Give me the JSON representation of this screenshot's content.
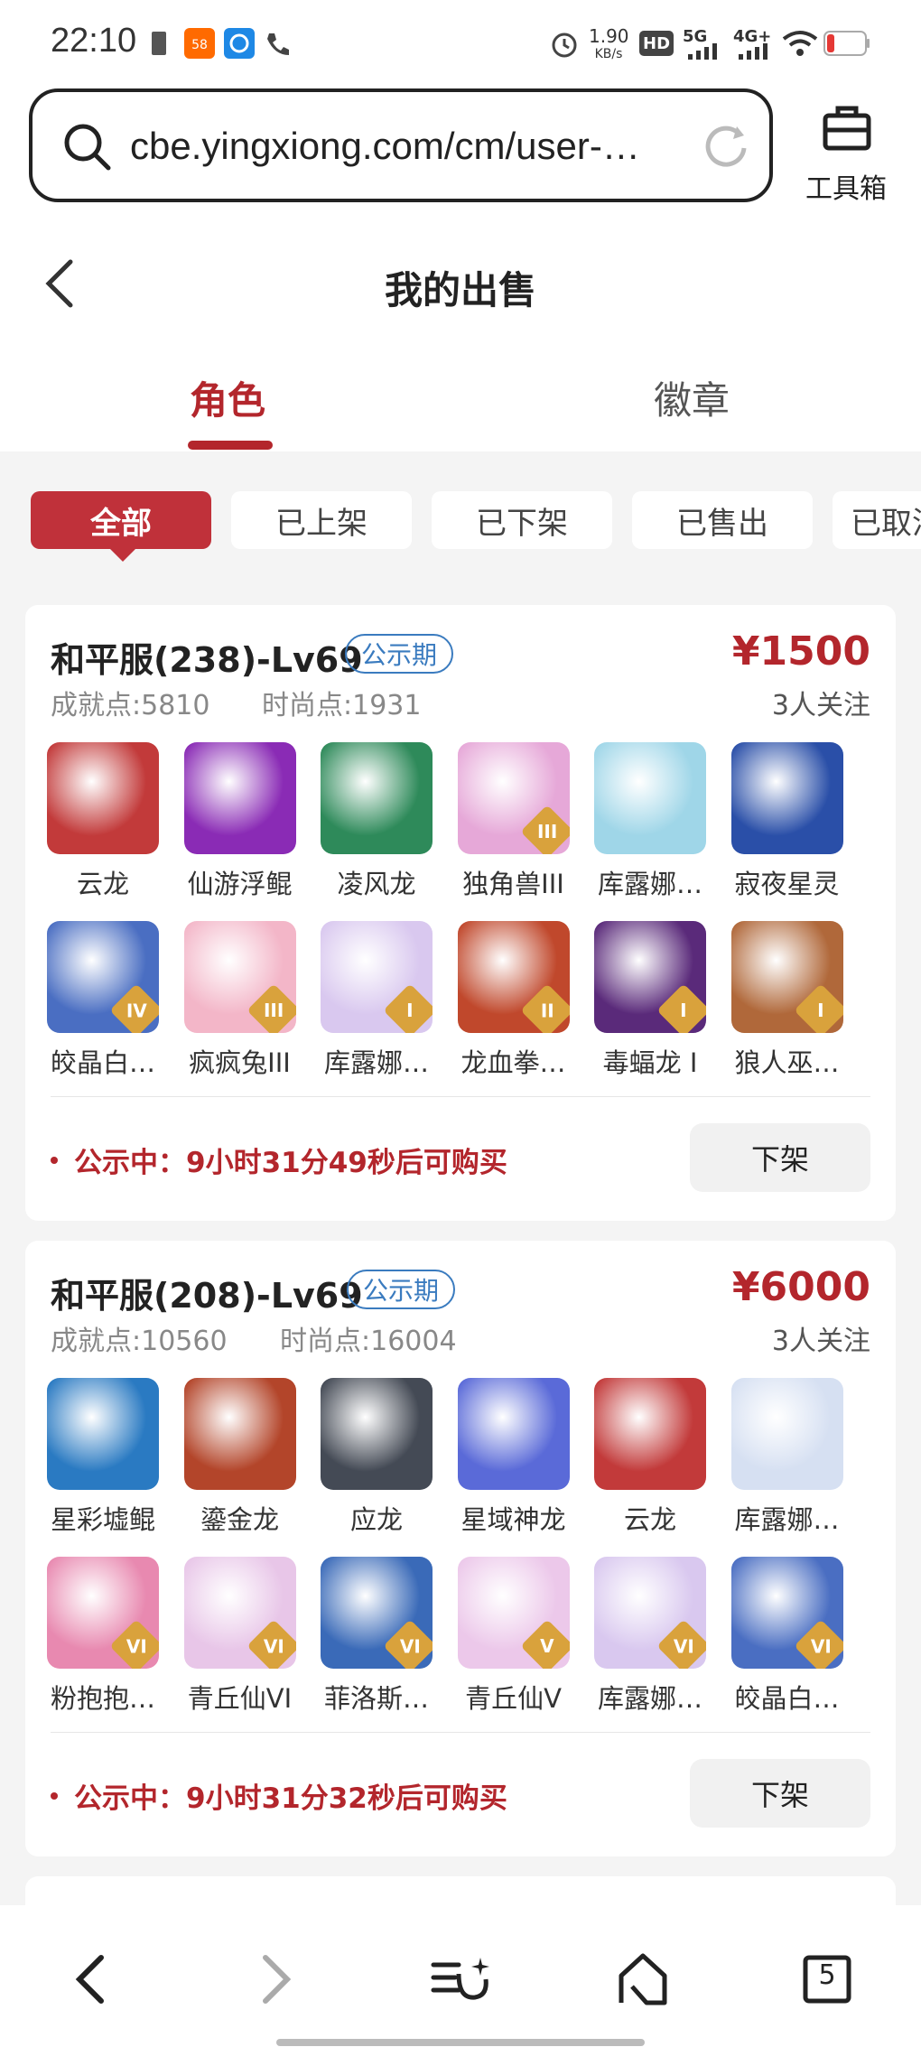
{
  "status_bar": {
    "time": "22:10",
    "net_speed": "1.90",
    "net_unit": "KB/s",
    "hd": "HD",
    "sig1": "5G",
    "sig2": "4G+"
  },
  "browser": {
    "url": "cbe.yingxiong.com/cm/user-…",
    "toolbox_label": "工具箱"
  },
  "header": {
    "title": "我的出售",
    "tabs": [
      "角色",
      "徽章"
    ]
  },
  "filters": [
    "全部",
    "已上架",
    "已下架",
    "已售出",
    "已取消"
  ],
  "listings": [
    {
      "server": "和平服(238)-Lv69",
      "badge": "公示期",
      "price": "¥1500",
      "followers": "3人关注",
      "achievement_label": "成就点:",
      "achievement": "5810",
      "fashion_label": "时尚点:",
      "fashion": "1931",
      "pets": [
        {
          "name": "云龙",
          "color": "#c23a3a",
          "tier": ""
        },
        {
          "name": "仙游浮鲲",
          "color": "#8a2bb5",
          "tier": ""
        },
        {
          "name": "凌风龙",
          "color": "#2e8a5a",
          "tier": ""
        },
        {
          "name": "独角兽III",
          "color": "#e6a8d8",
          "tier": "III"
        },
        {
          "name": "库露娜…",
          "color": "#9fd6e8",
          "tier": ""
        },
        {
          "name": "寂夜星灵",
          "color": "#2a4fa8",
          "tier": ""
        },
        {
          "name": "皎晶白…",
          "color": "#4a6ec2",
          "tier": "IV"
        },
        {
          "name": "疯疯兔III",
          "color": "#f3b6c8",
          "tier": "III"
        },
        {
          "name": "库露娜…",
          "color": "#d9c8ef",
          "tier": "I"
        },
        {
          "name": "龙血拳…",
          "color": "#c0482c",
          "tier": "II"
        },
        {
          "name": "毒蝠龙 I",
          "color": "#5a2a7a",
          "tier": "I"
        },
        {
          "name": "狼人巫…",
          "color": "#b0683a",
          "tier": "I"
        }
      ],
      "notice": "公示中：9小时31分49秒后可购买",
      "action": "下架"
    },
    {
      "server": "和平服(208)-Lv69",
      "badge": "公示期",
      "price": "¥6000",
      "followers": "3人关注",
      "achievement_label": "成就点:",
      "achievement": "10560",
      "fashion_label": "时尚点:",
      "fashion": "16004",
      "pets": [
        {
          "name": "星彩墟鲲",
          "color": "#2a7ac2",
          "tier": ""
        },
        {
          "name": "鎏金龙",
          "color": "#b3452a",
          "tier": ""
        },
        {
          "name": "应龙",
          "color": "#444a55",
          "tier": ""
        },
        {
          "name": "星域神龙",
          "color": "#5a6ad8",
          "tier": ""
        },
        {
          "name": "云龙",
          "color": "#c23a3a",
          "tier": ""
        },
        {
          "name": "库露娜…",
          "color": "#d6e0f2",
          "tier": ""
        },
        {
          "name": "粉抱抱…",
          "color": "#e889b0",
          "tier": "VI"
        },
        {
          "name": "青丘仙VI",
          "color": "#e8c6e8",
          "tier": "VI"
        },
        {
          "name": "菲洛斯…",
          "color": "#3a6ab8",
          "tier": "VI"
        },
        {
          "name": "青丘仙V",
          "color": "#ecc8ea",
          "tier": "V"
        },
        {
          "name": "库露娜…",
          "color": "#d9c8ef",
          "tier": "VI"
        },
        {
          "name": "皎晶白…",
          "color": "#4a6ec2",
          "tier": "VI"
        }
      ],
      "notice": "公示中：9小时31分32秒后可购买",
      "action": "下架"
    }
  ],
  "bottom_bar": {
    "tab_count": "5"
  },
  "colors": {
    "accent": "#b3262c",
    "badge_blue": "#3a7bbf"
  }
}
